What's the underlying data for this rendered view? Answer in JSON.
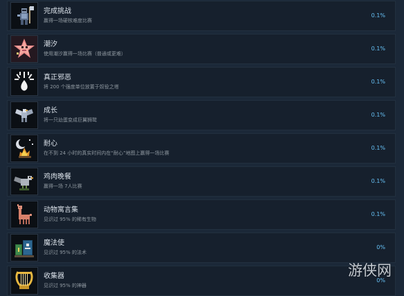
{
  "achievements": [
    {
      "title": "完成挑战",
      "description": "赢得一场硬核难度比赛",
      "percent": "0.1%",
      "icon": "armored-knight-axe-icon"
    },
    {
      "title": "潮汐",
      "description": "使用潮汐赢得一场比赛（普通或更难）",
      "percent": "0.1%",
      "icon": "pink-starfish-creature-icon"
    },
    {
      "title": "真正邪恶",
      "description": "将 200 个强度单位放置于奴役之塔",
      "percent": "0.1%",
      "icon": "white-splash-drop-icon"
    },
    {
      "title": "成长",
      "description": "将一只幼蛋变成巨翼狮鹫",
      "percent": "0.1%",
      "icon": "griffin-icon"
    },
    {
      "title": "耐心",
      "description": "在不到 24 小时的真实时间内在“耐心”地图上赢得一场比赛",
      "percent": "0.1%",
      "icon": "moon-campfire-icon"
    },
    {
      "title": "鸡肉晚餐",
      "description": "赢得一场 7人比赛",
      "percent": "0.1%",
      "icon": "chicken-bird-icon"
    },
    {
      "title": "动物寓言集",
      "description": "见识过 95% 的稀有生物",
      "percent": "0.1%",
      "icon": "llama-creature-icon"
    },
    {
      "title": "魔法使",
      "description": "见识过 95% 的法术",
      "percent": "0%",
      "icon": "spellbooks-icon"
    },
    {
      "title": "收集器",
      "description": "见识过 95% 的神器",
      "percent": "0%",
      "icon": "golden-lyre-icon"
    }
  ],
  "watermark": {
    "text": "游侠网"
  },
  "colors": {
    "background": "#1b2838",
    "row": "#16202d",
    "percent": "#66c0f4",
    "title": "#d9e0e8",
    "description": "#8f98a0"
  }
}
